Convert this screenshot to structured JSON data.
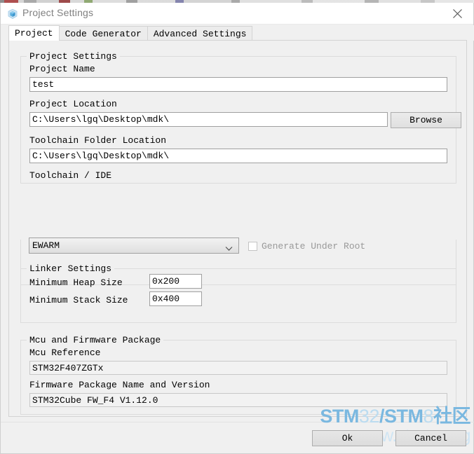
{
  "window": {
    "title": "Project Settings",
    "icon": "cube-icon",
    "close_label": "×"
  },
  "tabs": [
    {
      "label": "Project",
      "active": true
    },
    {
      "label": "Code Generator",
      "active": false
    },
    {
      "label": "Advanced Settings",
      "active": false
    }
  ],
  "project_settings": {
    "group_title": "Project Settings",
    "project_name_label": "Project Name",
    "project_name_value": "test",
    "project_location_label": "Project Location",
    "project_location_value": "C:\\Users\\lgq\\Desktop\\mdk\\",
    "browse_label": "Browse",
    "toolchain_folder_label": "Toolchain Folder Location",
    "toolchain_folder_value": "C:\\Users\\lgq\\Desktop\\mdk\\",
    "toolchain_ide_label": "Toolchain / IDE",
    "toolchain_ide_value": "EWARM",
    "generate_under_root_label": "Generate Under Root",
    "generate_under_root_checked": false
  },
  "linker_settings": {
    "group_title": "Linker Settings",
    "min_heap_label": "Minimum Heap Size",
    "min_heap_value": "0x200",
    "min_stack_label": "Minimum Stack Size",
    "min_stack_value": "0x400"
  },
  "mcu_firmware": {
    "group_title": "Mcu and Firmware Package",
    "mcu_reference_label": "Mcu Reference",
    "mcu_reference_value": "STM32F407ZGTx",
    "firmware_label": "Firmware Package Name and Version",
    "firmware_value": "STM32Cube FW_F4 V1.12.0"
  },
  "footer": {
    "ok_label": "Ok",
    "cancel_label": "Cancel"
  },
  "watermark": {
    "line1_part1": "STM",
    "line1_part2": "32",
    "line1_part3": "/STM",
    "line1_part4": "8",
    "line1_part5": "社区",
    "line2": "www.stmcu.org"
  },
  "colors": {
    "watermark_blue": "#7ab8e0",
    "watermark_light": "#cfe5f4",
    "title_text": "#808080",
    "window_bg": "#f0f0f0"
  }
}
